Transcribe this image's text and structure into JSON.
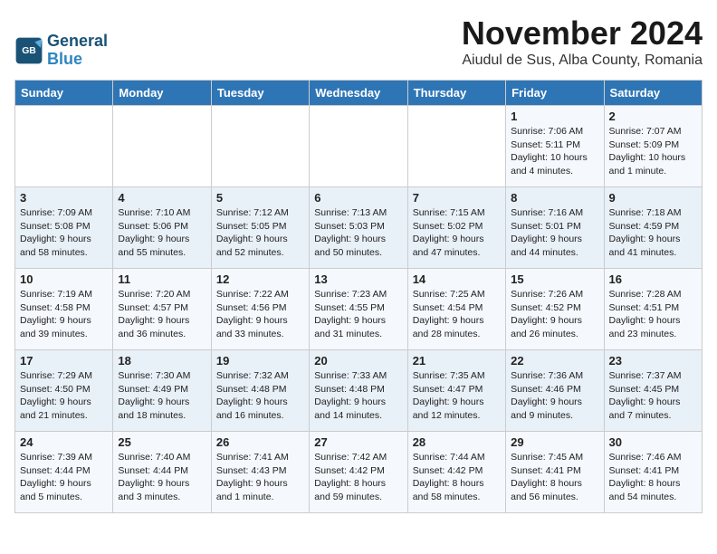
{
  "logo": {
    "line1": "General",
    "line2": "Blue"
  },
  "title": "November 2024",
  "location": "Aiudul de Sus, Alba County, Romania",
  "weekdays": [
    "Sunday",
    "Monday",
    "Tuesday",
    "Wednesday",
    "Thursday",
    "Friday",
    "Saturday"
  ],
  "weeks": [
    [
      {
        "day": "",
        "info": ""
      },
      {
        "day": "",
        "info": ""
      },
      {
        "day": "",
        "info": ""
      },
      {
        "day": "",
        "info": ""
      },
      {
        "day": "",
        "info": ""
      },
      {
        "day": "1",
        "info": "Sunrise: 7:06 AM\nSunset: 5:11 PM\nDaylight: 10 hours\nand 4 minutes."
      },
      {
        "day": "2",
        "info": "Sunrise: 7:07 AM\nSunset: 5:09 PM\nDaylight: 10 hours\nand 1 minute."
      }
    ],
    [
      {
        "day": "3",
        "info": "Sunrise: 7:09 AM\nSunset: 5:08 PM\nDaylight: 9 hours\nand 58 minutes."
      },
      {
        "day": "4",
        "info": "Sunrise: 7:10 AM\nSunset: 5:06 PM\nDaylight: 9 hours\nand 55 minutes."
      },
      {
        "day": "5",
        "info": "Sunrise: 7:12 AM\nSunset: 5:05 PM\nDaylight: 9 hours\nand 52 minutes."
      },
      {
        "day": "6",
        "info": "Sunrise: 7:13 AM\nSunset: 5:03 PM\nDaylight: 9 hours\nand 50 minutes."
      },
      {
        "day": "7",
        "info": "Sunrise: 7:15 AM\nSunset: 5:02 PM\nDaylight: 9 hours\nand 47 minutes."
      },
      {
        "day": "8",
        "info": "Sunrise: 7:16 AM\nSunset: 5:01 PM\nDaylight: 9 hours\nand 44 minutes."
      },
      {
        "day": "9",
        "info": "Sunrise: 7:18 AM\nSunset: 4:59 PM\nDaylight: 9 hours\nand 41 minutes."
      }
    ],
    [
      {
        "day": "10",
        "info": "Sunrise: 7:19 AM\nSunset: 4:58 PM\nDaylight: 9 hours\nand 39 minutes."
      },
      {
        "day": "11",
        "info": "Sunrise: 7:20 AM\nSunset: 4:57 PM\nDaylight: 9 hours\nand 36 minutes."
      },
      {
        "day": "12",
        "info": "Sunrise: 7:22 AM\nSunset: 4:56 PM\nDaylight: 9 hours\nand 33 minutes."
      },
      {
        "day": "13",
        "info": "Sunrise: 7:23 AM\nSunset: 4:55 PM\nDaylight: 9 hours\nand 31 minutes."
      },
      {
        "day": "14",
        "info": "Sunrise: 7:25 AM\nSunset: 4:54 PM\nDaylight: 9 hours\nand 28 minutes."
      },
      {
        "day": "15",
        "info": "Sunrise: 7:26 AM\nSunset: 4:52 PM\nDaylight: 9 hours\nand 26 minutes."
      },
      {
        "day": "16",
        "info": "Sunrise: 7:28 AM\nSunset: 4:51 PM\nDaylight: 9 hours\nand 23 minutes."
      }
    ],
    [
      {
        "day": "17",
        "info": "Sunrise: 7:29 AM\nSunset: 4:50 PM\nDaylight: 9 hours\nand 21 minutes."
      },
      {
        "day": "18",
        "info": "Sunrise: 7:30 AM\nSunset: 4:49 PM\nDaylight: 9 hours\nand 18 minutes."
      },
      {
        "day": "19",
        "info": "Sunrise: 7:32 AM\nSunset: 4:48 PM\nDaylight: 9 hours\nand 16 minutes."
      },
      {
        "day": "20",
        "info": "Sunrise: 7:33 AM\nSunset: 4:48 PM\nDaylight: 9 hours\nand 14 minutes."
      },
      {
        "day": "21",
        "info": "Sunrise: 7:35 AM\nSunset: 4:47 PM\nDaylight: 9 hours\nand 12 minutes."
      },
      {
        "day": "22",
        "info": "Sunrise: 7:36 AM\nSunset: 4:46 PM\nDaylight: 9 hours\nand 9 minutes."
      },
      {
        "day": "23",
        "info": "Sunrise: 7:37 AM\nSunset: 4:45 PM\nDaylight: 9 hours\nand 7 minutes."
      }
    ],
    [
      {
        "day": "24",
        "info": "Sunrise: 7:39 AM\nSunset: 4:44 PM\nDaylight: 9 hours\nand 5 minutes."
      },
      {
        "day": "25",
        "info": "Sunrise: 7:40 AM\nSunset: 4:44 PM\nDaylight: 9 hours\nand 3 minutes."
      },
      {
        "day": "26",
        "info": "Sunrise: 7:41 AM\nSunset: 4:43 PM\nDaylight: 9 hours\nand 1 minute."
      },
      {
        "day": "27",
        "info": "Sunrise: 7:42 AM\nSunset: 4:42 PM\nDaylight: 8 hours\nand 59 minutes."
      },
      {
        "day": "28",
        "info": "Sunrise: 7:44 AM\nSunset: 4:42 PM\nDaylight: 8 hours\nand 58 minutes."
      },
      {
        "day": "29",
        "info": "Sunrise: 7:45 AM\nSunset: 4:41 PM\nDaylight: 8 hours\nand 56 minutes."
      },
      {
        "day": "30",
        "info": "Sunrise: 7:46 AM\nSunset: 4:41 PM\nDaylight: 8 hours\nand 54 minutes."
      }
    ]
  ]
}
